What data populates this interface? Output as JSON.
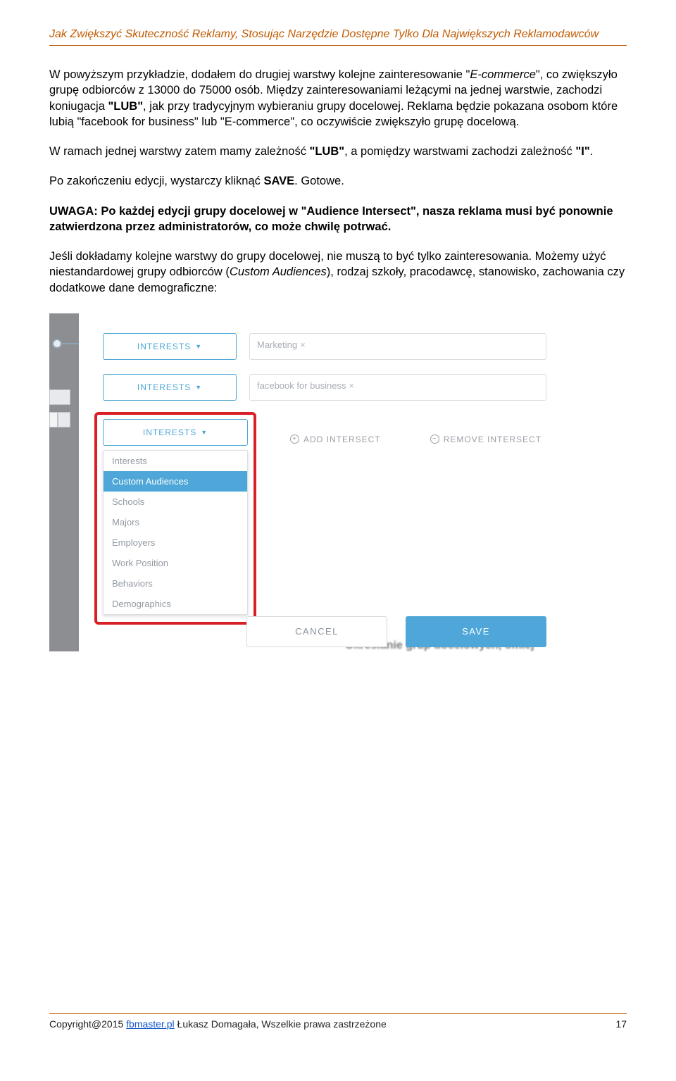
{
  "header": "Jak Zwiększyć Skuteczność Reklamy, Stosując Narzędzie Dostępne Tylko Dla Największych Reklamodawców",
  "p1a": "W powyższym przykładzie, dodałem do drugiej warstwy kolejne zainteresowanie \"",
  "p1i": "E-commerce",
  "p1b": "\", co zwiększyło grupę odbiorców z 13000 do 75000 osób. Między zainteresowaniami leżącymi na jednej warstwie, zachodzi koniugacja ",
  "p1c": "\"LUB\"",
  "p1d": ", jak przy tradycyjnym wybieraniu grupy docelowej. Reklama będzie pokazana osobom które lubią \"facebook for business\" lub \"E-commerce\", co oczywiście zwiększyło grupę docelową.",
  "p2a": "W ramach jednej warstwy zatem mamy zależność ",
  "p2b": "\"LUB\"",
  "p2c": ", a pomiędzy warstwami zachodzi zależność ",
  "p2d": "\"I\"",
  "p2e": ".",
  "p3a": "Po zakończeniu edycji, wystarczy kliknąć ",
  "p3b": "SAVE",
  "p3c": ". Gotowe.",
  "p4": "UWAGA: Po każdej edycji grupy docelowej w \"Audience Intersect\", nasza reklama musi być ponownie zatwierdzona przez administratorów, co może chwilę potrwać.",
  "p5a": "Jeśli dokładamy kolejne warstwy do grupy docelowej, nie muszą to być tylko zainteresowania. Możemy użyć niestandardowej grupy odbiorców (",
  "p5i": "Custom Audiences",
  "p5b": "), rodzaj szkoły, pracodawcę, stanowisko, zachowania czy dodatkowe dane demograficzne:",
  "pill_label": "INTERESTS",
  "tag1": "Marketing",
  "tag2": "facebook for business",
  "dd": {
    "o0": "Interests",
    "o1": "Custom Audiences",
    "o2": "Schools",
    "o3": "Majors",
    "o4": "Employers",
    "o5": "Work Position",
    "o6": "Behaviors",
    "o7": "Demographics"
  },
  "add_btn": "ADD INTERSECT",
  "rem_btn": "REMOVE INTERSECT",
  "cancel": "CANCEL",
  "save": "SAVE",
  "blur_caption": "Określanie grup docelowych, omiej",
  "footer_left_a": "Copyright@2015 ",
  "footer_link": "fbmaster.pl",
  "footer_left_b": "  Łukasz Domagała, Wszelkie prawa zastrzeżone",
  "footer_page": "17"
}
